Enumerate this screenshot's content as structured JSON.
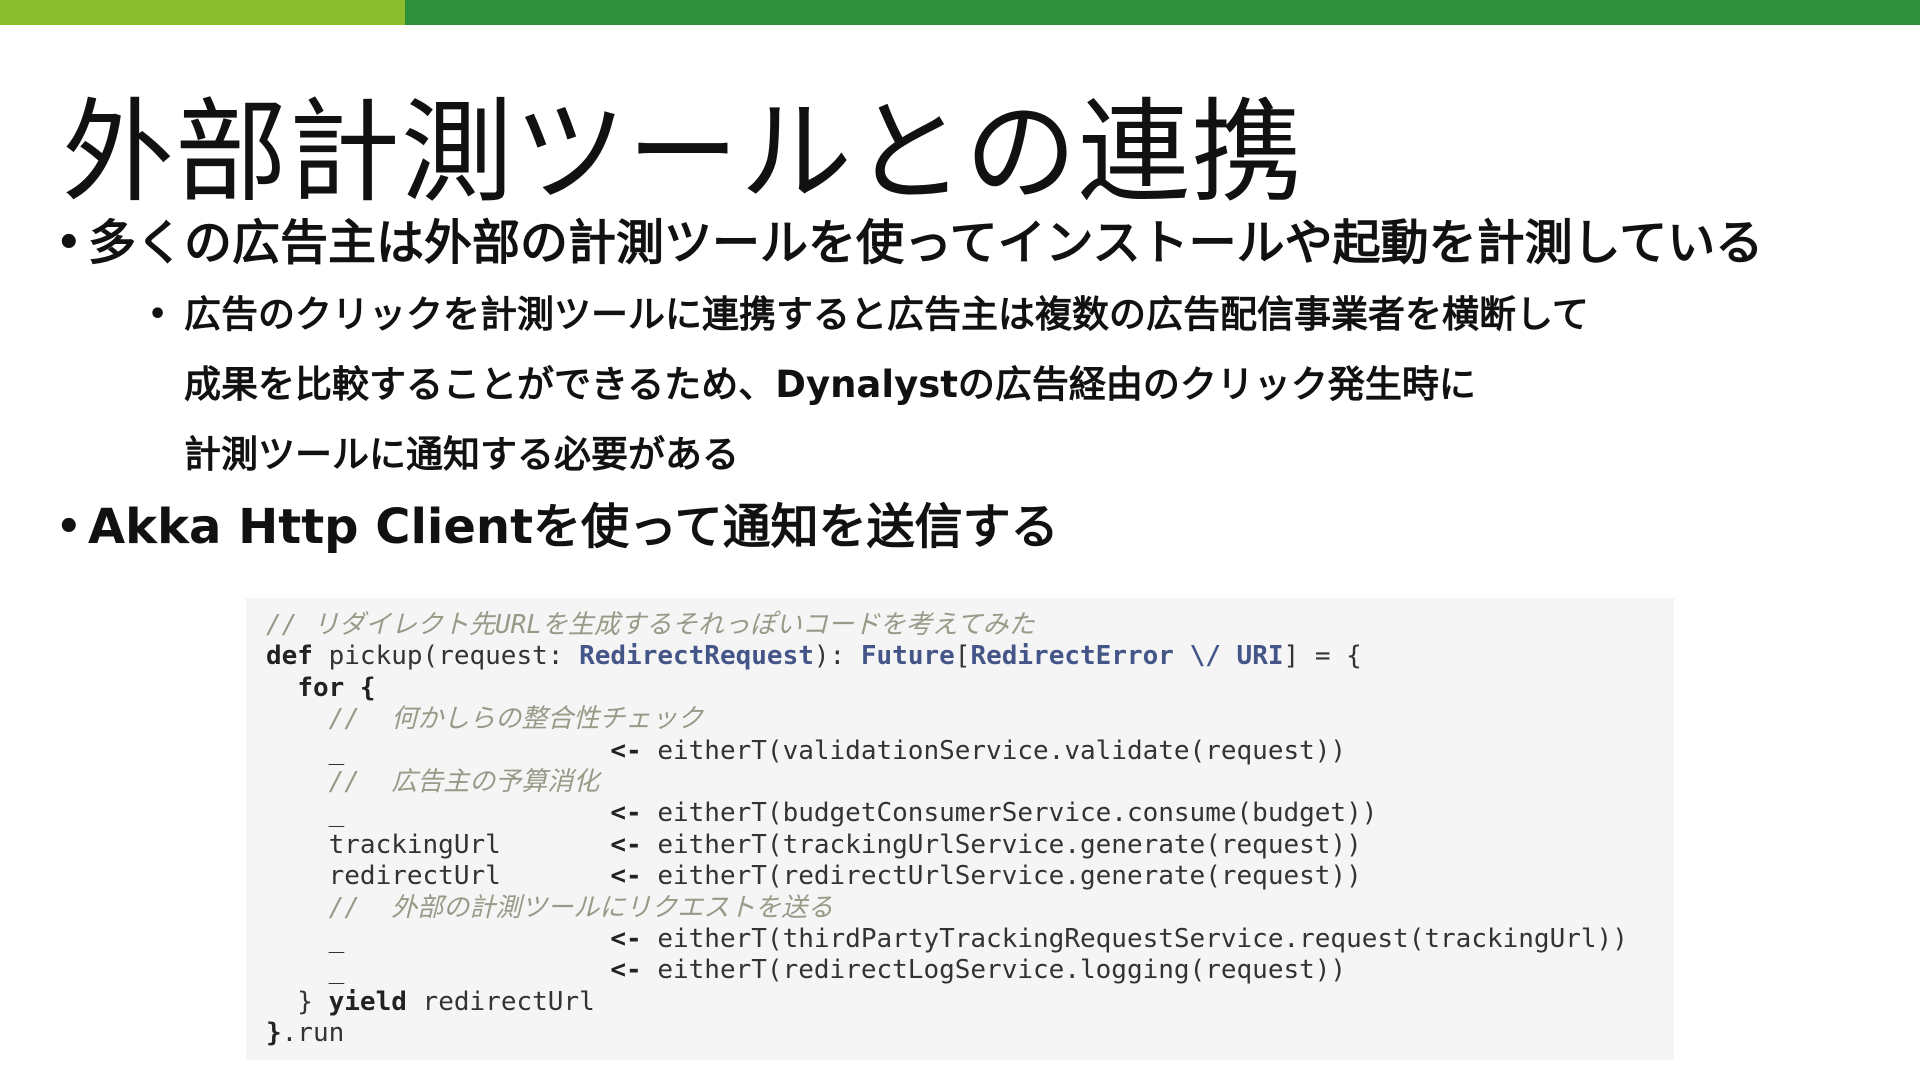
{
  "slide": {
    "title": "外部計測ツールとの連携",
    "accent_colors": {
      "bar_left": "#8bbd2f",
      "bar_right": "#2f8f3b"
    },
    "bullets": {
      "first": "多くの広告主は外部の計測ツールを使ってインストールや起動を計測している",
      "sub_lines": [
        "広告のクリックを計測ツールに連携すると広告主は複数の広告配信事業者を横断して",
        "成果を比較することができるため、Dynalystの広告経由のクリック発生時に",
        "計測ツールに通知する必要がある"
      ],
      "second": "Akka Http Clientを使って通知を送信する"
    }
  },
  "code": {
    "c1": "// リダイレクト先URLを生成するそれっぽいコードを考えてみた",
    "l2_def": "def",
    "l2_a": " pickup(request: ",
    "l2_t1": "RedirectRequest",
    "l2_b": "): ",
    "l2_t2": "Future",
    "l2_c": "[",
    "l2_t3": "RedirectError \\/ URI",
    "l2_d": "] = {",
    "l3_indent": "  ",
    "l3_for": "for {",
    "c4": "    //  何かしらの整合性チェック",
    "l5_a": "    _                 ",
    "l5_arrow": "<-",
    "l5_b": " eitherT(validationService.validate(request))",
    "c6": "    //  広告主の予算消化",
    "l7_a": "    _                 ",
    "l7_arrow": "<-",
    "l7_b": " eitherT(budgetConsumerService.consume(budget))",
    "l8_a": "    trackingUrl       ",
    "l8_arrow": "<-",
    "l8_b": " eitherT(trackingUrlService.generate(request))",
    "l9_a": "    redirectUrl       ",
    "l9_arrow": "<-",
    "l9_b": " eitherT(redirectUrlService.generate(request))",
    "c10": "    //  外部の計測ツールにリクエストを送る",
    "l11_a": "    _                 ",
    "l11_arrow": "<-",
    "l11_b": " eitherT(thirdPartyTrackingRequestService.request(trackingUrl))",
    "l12_a": "    _                 ",
    "l12_arrow": "<-",
    "l12_b": " eitherT(redirectLogService.logging(request))",
    "l13_a": "  } ",
    "l13_yield": "yield",
    "l13_b": " redirectUrl",
    "l14_a": "}",
    "l14_b": ".run"
  }
}
